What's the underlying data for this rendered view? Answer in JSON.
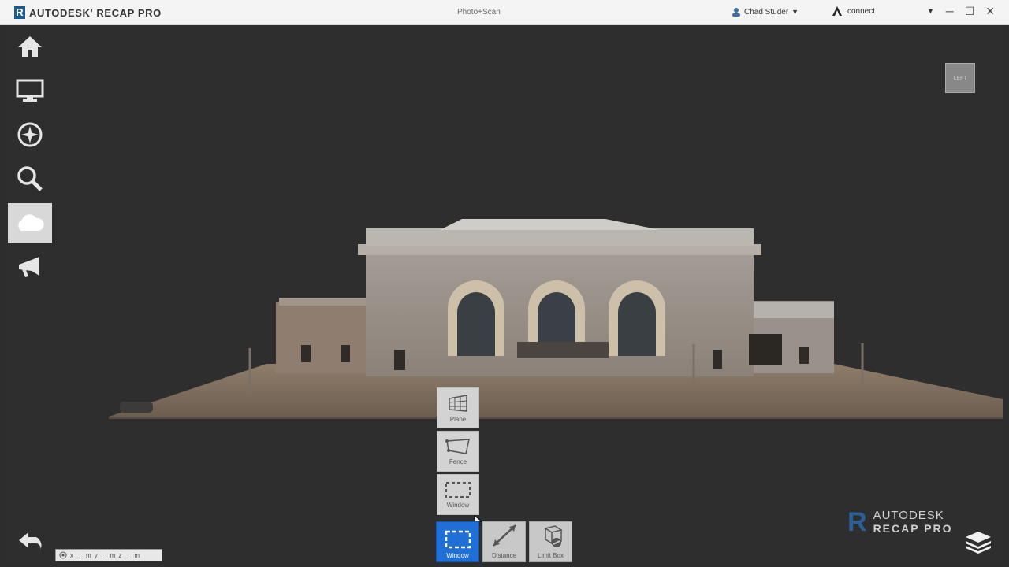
{
  "titlebar": {
    "brand_name": "AUTODESK' RECAP PRO",
    "document_title": "Photo+Scan",
    "user_name": "Chad Studer",
    "connect_label": "connect",
    "logo_letter": "R"
  },
  "sidebar": {
    "items": [
      {
        "icon": "home-icon"
      },
      {
        "icon": "monitor-icon"
      },
      {
        "icon": "navigate-icon"
      },
      {
        "icon": "search-icon"
      },
      {
        "icon": "cloud-icon",
        "active": true
      },
      {
        "icon": "announce-icon"
      }
    ]
  },
  "view_cube": {
    "label": "LEFT"
  },
  "selection_tools": {
    "plane_label": "Plane",
    "fence_label": "Fence",
    "window_label": "Window"
  },
  "bottom_tools": {
    "window_label": "Window",
    "distance_label": "Distance",
    "limit_box_label": "Limit Box"
  },
  "coordinates": {
    "x_label": "x",
    "y_label": "y",
    "z_label": "z",
    "unit": "m"
  },
  "brand_mark": {
    "line1": "AUTODESK",
    "line2": "RECAP PRO"
  },
  "colors": {
    "accent": "#1f6fd6",
    "viewport": "#2e2e2e",
    "brand": "#1c5b92"
  }
}
